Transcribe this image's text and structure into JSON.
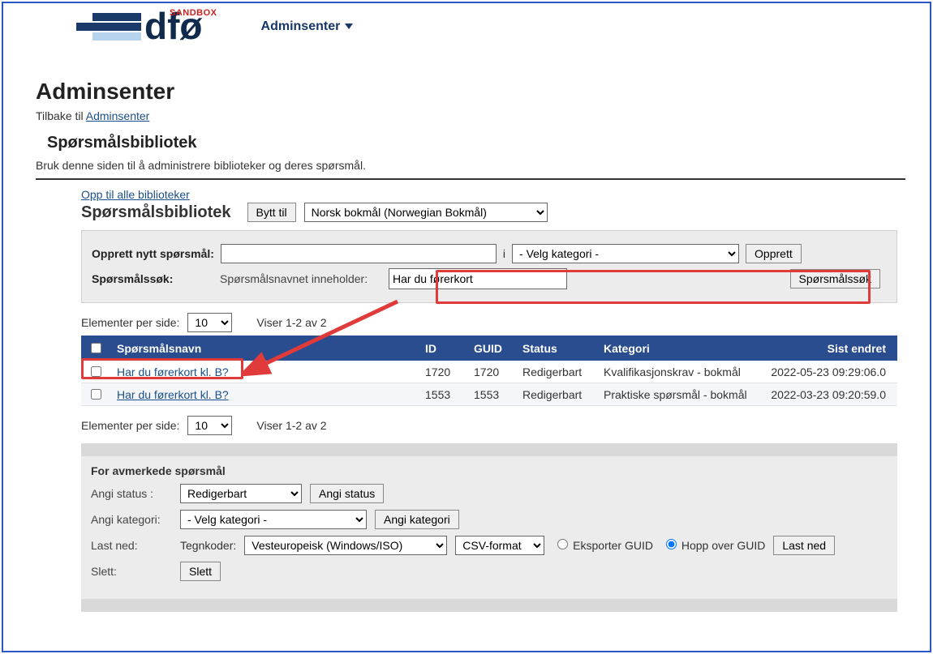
{
  "logo": {
    "sandbox": "SANDBOX"
  },
  "nav": {
    "adminsenter": "Adminsenter"
  },
  "page": {
    "title": "Adminsenter",
    "back_prefix": "Tilbake til ",
    "back_link": "Adminsenter",
    "section_title": "Spørsmålsbibliotek",
    "section_desc": "Bruk denne siden til å administrere biblioteker og deres spørsmål."
  },
  "library": {
    "up_link": "Opp til alle biblioteker",
    "title": "Spørsmålsbibliotek",
    "switch_btn": "Bytt til",
    "lang_selected": "Norsk bokmål (Norwegian Bokmål)"
  },
  "create": {
    "label": "Opprett nytt spørsmål:",
    "in_word": "i",
    "category_placeholder": "- Velg kategori -",
    "btn": "Opprett"
  },
  "search": {
    "label": "Spørsmålssøk:",
    "hint": "Spørsmålsnavnet inneholder:",
    "value": "Har du førerkort",
    "btn": "Spørsmålssøk"
  },
  "pager": {
    "per_page_label": "Elementer per side:",
    "per_page_value": "10",
    "showing": "Viser 1-2 av 2"
  },
  "table": {
    "headers": {
      "name": "Spørsmålsnavn",
      "id": "ID",
      "guid": "GUID",
      "status": "Status",
      "category": "Kategori",
      "last_changed": "Sist endret"
    },
    "rows": [
      {
        "name": "Har du førerkort kl. B?",
        "id": "1720",
        "guid": "1720",
        "status": "Redigerbart",
        "category": "Kvalifikasjonskrav - bokmål",
        "last_changed": "2022-05-23 09:29:06.0"
      },
      {
        "name": "Har du førerkort kl. B?",
        "id": "1553",
        "guid": "1553",
        "status": "Redigerbart",
        "category": "Praktiske spørsmål - bokmål",
        "last_changed": "2022-03-23 09:20:59.0"
      }
    ]
  },
  "bulk": {
    "title": "For avmerkede spørsmål",
    "status_label": "Angi status :",
    "status_value": "Redigerbart",
    "status_btn": "Angi status",
    "cat_label": "Angi kategori:",
    "cat_value": "- Velg kategori -",
    "cat_btn": "Angi kategori",
    "download_label": "Last ned:",
    "enc_label": "Tegnkoder:",
    "enc_value": "Vesteuropeisk (Windows/ISO)",
    "fmt_value": "CSV-format",
    "export_guid": "Eksporter GUID",
    "skip_guid": "Hopp over GUID",
    "download_btn": "Last ned",
    "delete_label": "Slett:",
    "delete_btn": "Slett"
  }
}
